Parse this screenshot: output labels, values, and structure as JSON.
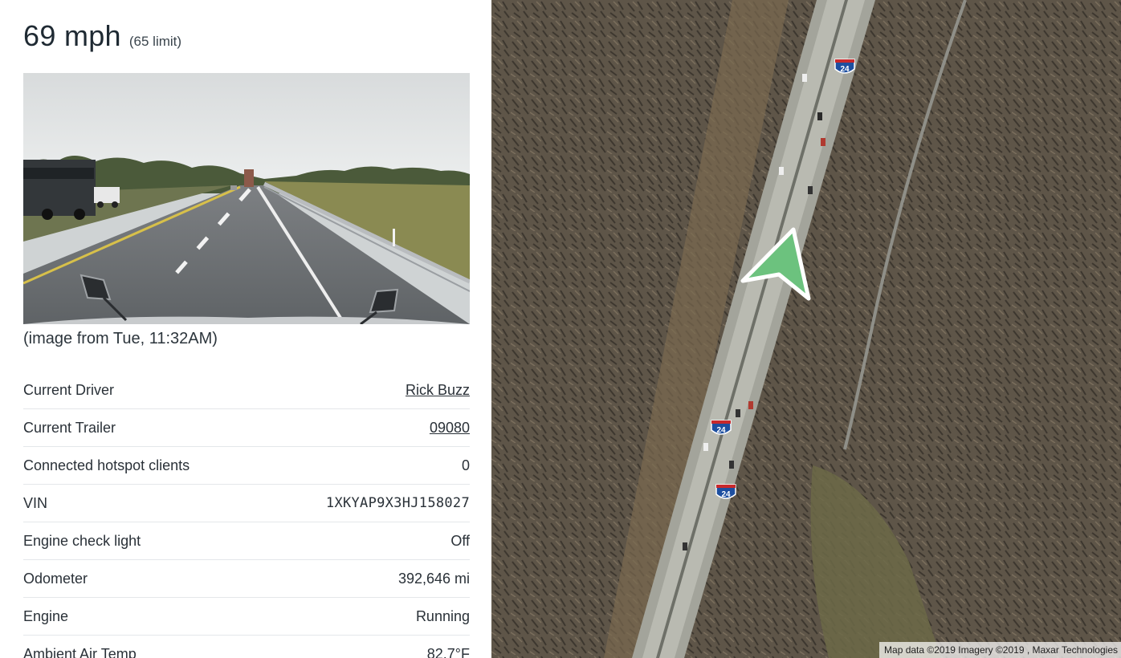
{
  "vehicle": {
    "speed": "69 mph",
    "speed_limit": "(65 limit)"
  },
  "camera": {
    "caption": "(image from Tue, 11:32AM)"
  },
  "stats": [
    {
      "label": "Current Driver",
      "value": "Rick Buzz",
      "link": true
    },
    {
      "label": "Current Trailer",
      "value": "09080",
      "link": true
    },
    {
      "label": "Connected hotspot clients",
      "value": "0",
      "link": false
    },
    {
      "label": "VIN",
      "value": "1XKYAP9X3HJ158027",
      "link": false
    },
    {
      "label": "Engine check light",
      "value": "Off",
      "link": false
    },
    {
      "label": "Odometer",
      "value": "392,646 mi",
      "link": false
    },
    {
      "label": "Engine",
      "value": "Running",
      "link": false
    },
    {
      "label": "Ambient Air Temp",
      "value": "82.7°F",
      "link": false
    }
  ],
  "map": {
    "attribution": "Map data ©2019 Imagery ©2019 , Maxar Technologies",
    "interstate_shields": [
      "24",
      "24",
      "24"
    ],
    "position_marker_color": "#6cc27e",
    "icons": [
      "vehicle-position-arrow-icon",
      "interstate-shield-icon"
    ]
  }
}
